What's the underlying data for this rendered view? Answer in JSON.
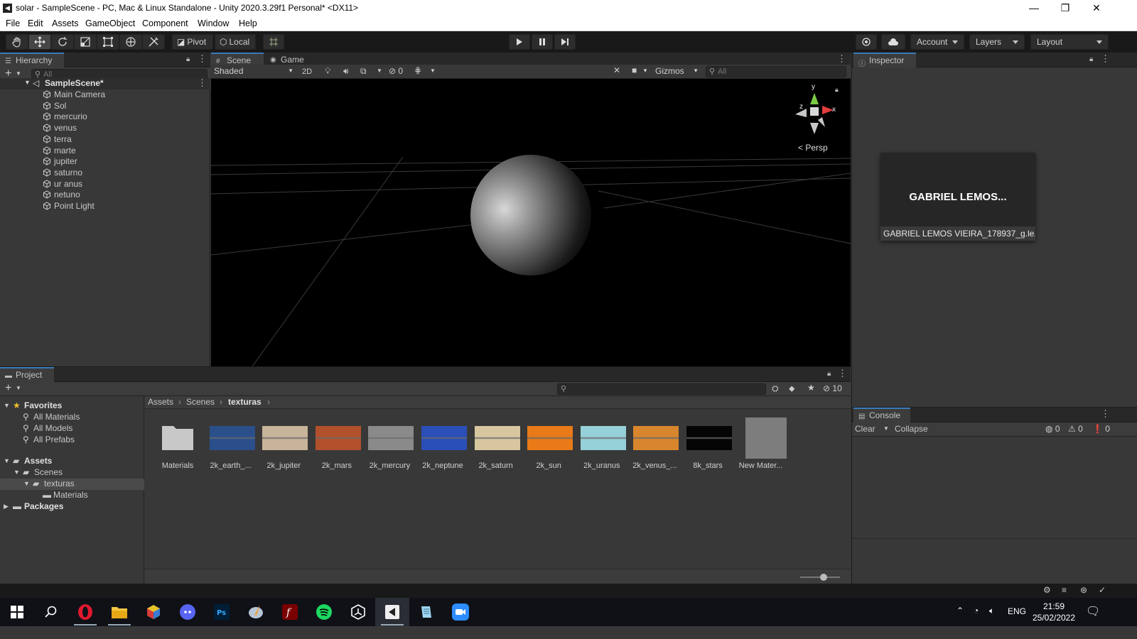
{
  "window": {
    "title": "solar - SampleScene - PC, Mac & Linux Standalone - Unity 2020.3.29f1 Personal* <DX11>",
    "controls": [
      "minimize-icon",
      "restore-icon",
      "close-icon"
    ]
  },
  "menu": [
    "File",
    "Edit",
    "Assets",
    "GameObject",
    "Component",
    "Window",
    "Help"
  ],
  "toolbar": {
    "tools": [
      "hand-tool-icon",
      "move-tool-icon",
      "rotate-tool-icon",
      "scale-tool-icon",
      "rect-tool-icon",
      "transform-tool-icon",
      "custom-tool-icon"
    ],
    "pivot_label": "Pivot",
    "local_label": "Local",
    "account_label": "Account",
    "layers_label": "Layers",
    "layout_label": "Layout"
  },
  "hierarchy": {
    "tab_label": "Hierarchy",
    "search_placeholder": "All",
    "scene_name": "SampleScene*",
    "items": [
      "Main Camera",
      "Sol",
      "mercurio",
      "venus",
      "terra",
      "marte",
      "jupiter",
      "saturno",
      "ur anus",
      "netuno",
      "Point Light"
    ]
  },
  "scene": {
    "tabs": [
      "Scene",
      "Game"
    ],
    "shading_mode": "Shaded",
    "twod_label": "2D",
    "hidden_count": "0",
    "gizmos_label": "Gizmos",
    "search_placeholder": "All",
    "persp_label": "Persp",
    "axis_x": "x",
    "axis_y": "y",
    "axis_z": "z"
  },
  "inspector": {
    "tab_label": "Inspector",
    "preview_title": "GABRIEL LEMOS...",
    "preview_caption": "GABRIEL LEMOS VIEIRA_178937_g.le..."
  },
  "project": {
    "tab_label": "Project",
    "favorites_label": "Favorites",
    "favorites": [
      "All Materials",
      "All Models",
      "All Prefabs"
    ],
    "assets_label": "Assets",
    "scenes_label": "Scenes",
    "texturas_label": "texturas",
    "materials_label": "Materials",
    "packages_label": "Packages",
    "breadcrumb": [
      "Assets",
      "Scenes",
      "texturas"
    ],
    "hidden_count": "10",
    "items": [
      {
        "label": "Materials",
        "kind": "folder"
      },
      {
        "label": "2k_earth_...",
        "kind": "texture",
        "color": "#2a4f8a"
      },
      {
        "label": "2k_jupiter",
        "kind": "texture",
        "color": "#c8b49a"
      },
      {
        "label": "2k_mars",
        "kind": "texture",
        "color": "#b2502c"
      },
      {
        "label": "2k_mercury",
        "kind": "texture",
        "color": "#8a8a8a"
      },
      {
        "label": "2k_neptune",
        "kind": "texture",
        "color": "#2a4fb8"
      },
      {
        "label": "2k_saturn",
        "kind": "texture",
        "color": "#d8c6a0"
      },
      {
        "label": "2k_sun",
        "kind": "texture",
        "color": "#e87a18"
      },
      {
        "label": "2k_uranus",
        "kind": "texture",
        "color": "#96d0d8"
      },
      {
        "label": "2k_venus_...",
        "kind": "texture",
        "color": "#d8862e"
      },
      {
        "label": "8k_stars",
        "kind": "texture",
        "color": "#050505"
      },
      {
        "label": "New Mater...",
        "kind": "material",
        "color": "#7d7d7d"
      }
    ]
  },
  "console": {
    "tab_label": "Console",
    "clear_label": "Clear",
    "collapse_label": "Collapse",
    "log_count": "0",
    "warning_count": "0",
    "error_count": "0"
  },
  "taskbar": {
    "apps": [
      "windows-start-icon",
      "search-icon",
      "opera-icon",
      "file-explorer-icon",
      "rubiks-cube-icon",
      "discord-icon",
      "photoshop-icon",
      "paint-icon",
      "flash-icon",
      "spotify-icon",
      "unity-hub-icon",
      "unity-editor-icon",
      "notepad-icon",
      "zoom-icon"
    ],
    "language": "ENG",
    "time": "21:59",
    "date": "25/02/2022"
  }
}
